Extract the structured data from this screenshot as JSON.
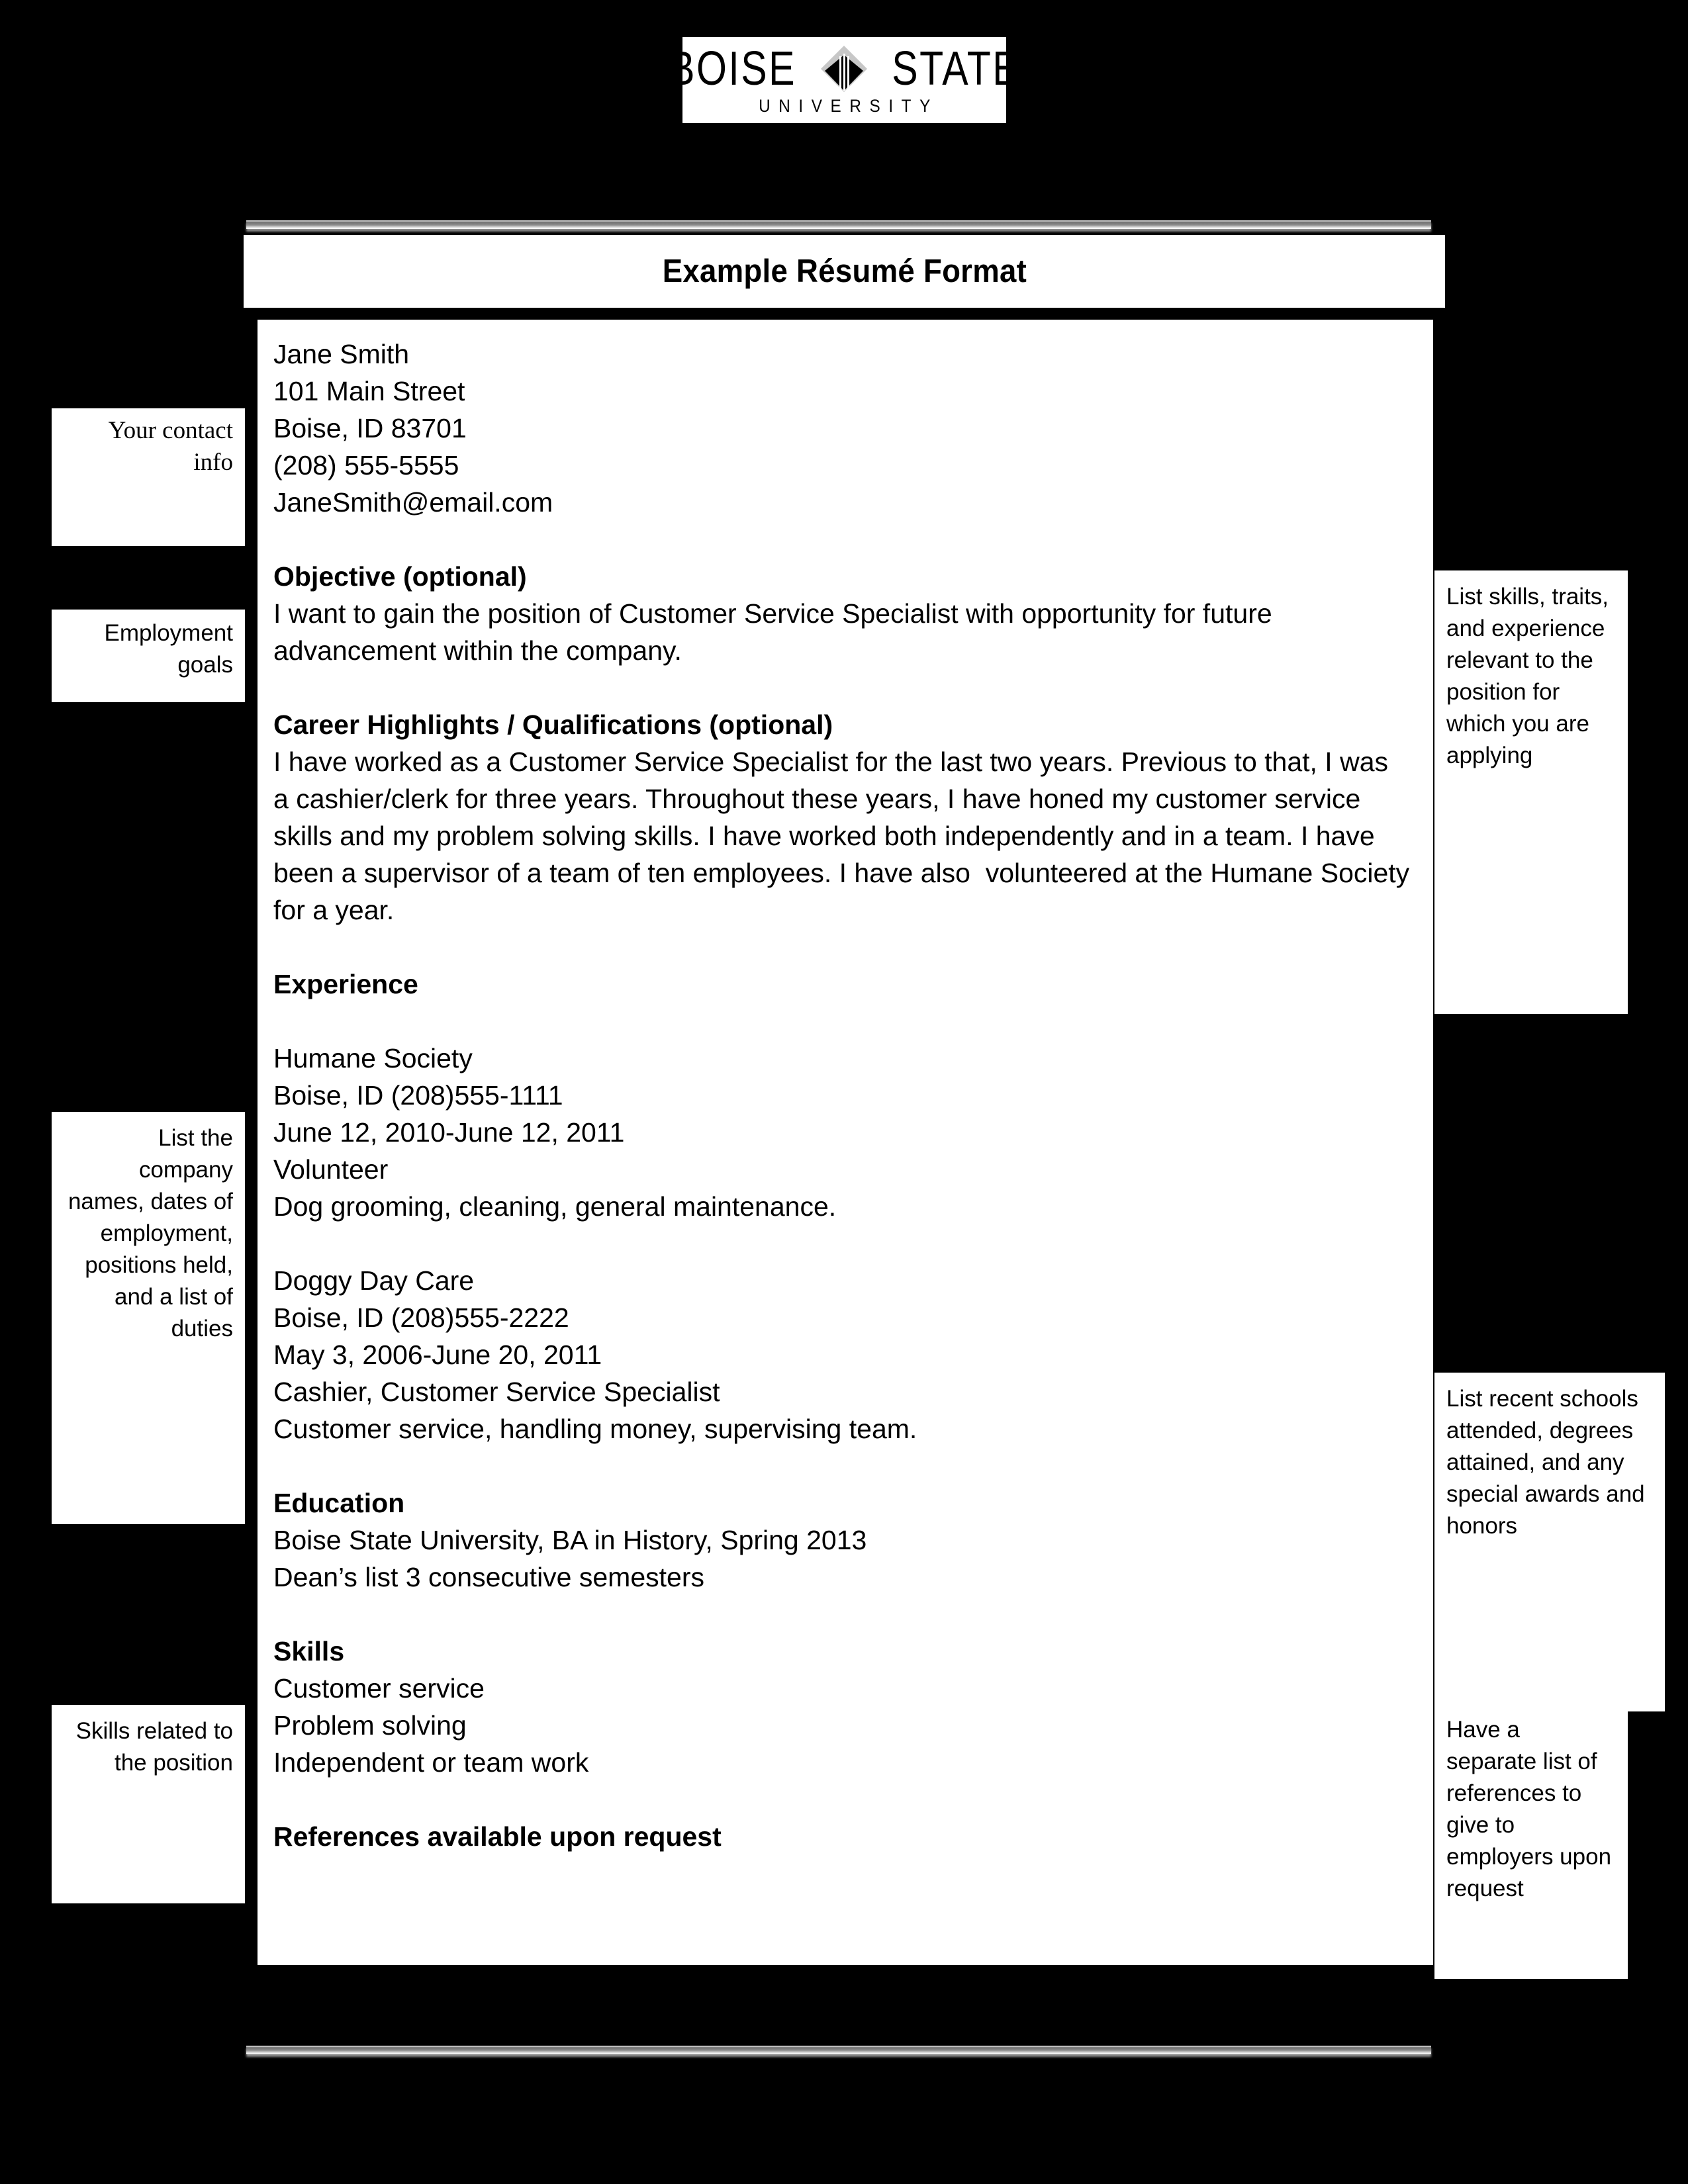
{
  "logo": {
    "word_left": "BOISE",
    "word_right": "STATE",
    "subword": "UNIVERSITY",
    "diamond_icon": "boise-state-diamond-icon"
  },
  "document": {
    "title": "Example Résumé Format"
  },
  "resume": {
    "contact": [
      "Jane Smith",
      "101 Main Street",
      "Boise, ID 83701",
      "(208) 555-5555",
      "JaneSmith@email.com"
    ],
    "objective": {
      "heading": "Objective (optional)",
      "body": "I want to gain the position of Customer Service Specialist with opportunity for future advancement within the company."
    },
    "career_highlights": {
      "heading": "Career Highlights / Qualifications (optional)",
      "body": "I have worked as a Customer Service Specialist for the last two years. Previous to that, I was a cashier/clerk for three years. Throughout these years, I have honed my customer service skills and my problem solving skills. I have worked both independently and in a team. I have been a supervisor of a team of ten employees. I have also  volunteered at the Humane Society for a year."
    },
    "experience": {
      "heading": "Experience",
      "jobs": [
        {
          "company": "Humane Society",
          "location_phone": "Boise, ID (208)555-1111",
          "dates": "June 12, 2010-June 12, 2011",
          "position": "Volunteer",
          "duties": "Dog grooming, cleaning, general maintenance."
        },
        {
          "company": "Doggy Day Care",
          "location_phone": "Boise, ID (208)555-2222",
          "dates": "May 3, 2006-June 20, 2011",
          "position": "Cashier, Customer Service Specialist",
          "duties": "Customer service, handling money, supervising team."
        }
      ]
    },
    "education": {
      "heading": "Education",
      "lines": [
        "Boise State University, BA in History, Spring 2013",
        "Dean’s list 3 consecutive semesters"
      ]
    },
    "skills": {
      "heading": "Skills",
      "lines": [
        "Customer service",
        "Problem solving",
        "Independent or team work"
      ]
    },
    "references": {
      "heading": "References available upon request"
    }
  },
  "annotations": {
    "left": [
      {
        "id": "contact-info",
        "text": "Your contact info"
      },
      {
        "id": "employment-goals",
        "text": "Employment goals"
      },
      {
        "id": "company-list",
        "text": "List the company names, dates of employment, positions held, and a list of duties"
      },
      {
        "id": "skills",
        "text": "Skills related to the position"
      }
    ],
    "right": [
      {
        "id": "list-skills",
        "text": "List skills, traits, and experience relevant to the position for which you are applying"
      },
      {
        "id": "education-notes",
        "text": "List recent schools attended, degrees attained, and any special awards and honors"
      },
      {
        "id": "references-notes",
        "text": "Have a separate list of references to give to employers upon request"
      }
    ]
  },
  "colors": {
    "page_background": "#000000",
    "panel_background": "#ffffff",
    "text": "#000000",
    "rule_gray": "#8f8f8f"
  }
}
